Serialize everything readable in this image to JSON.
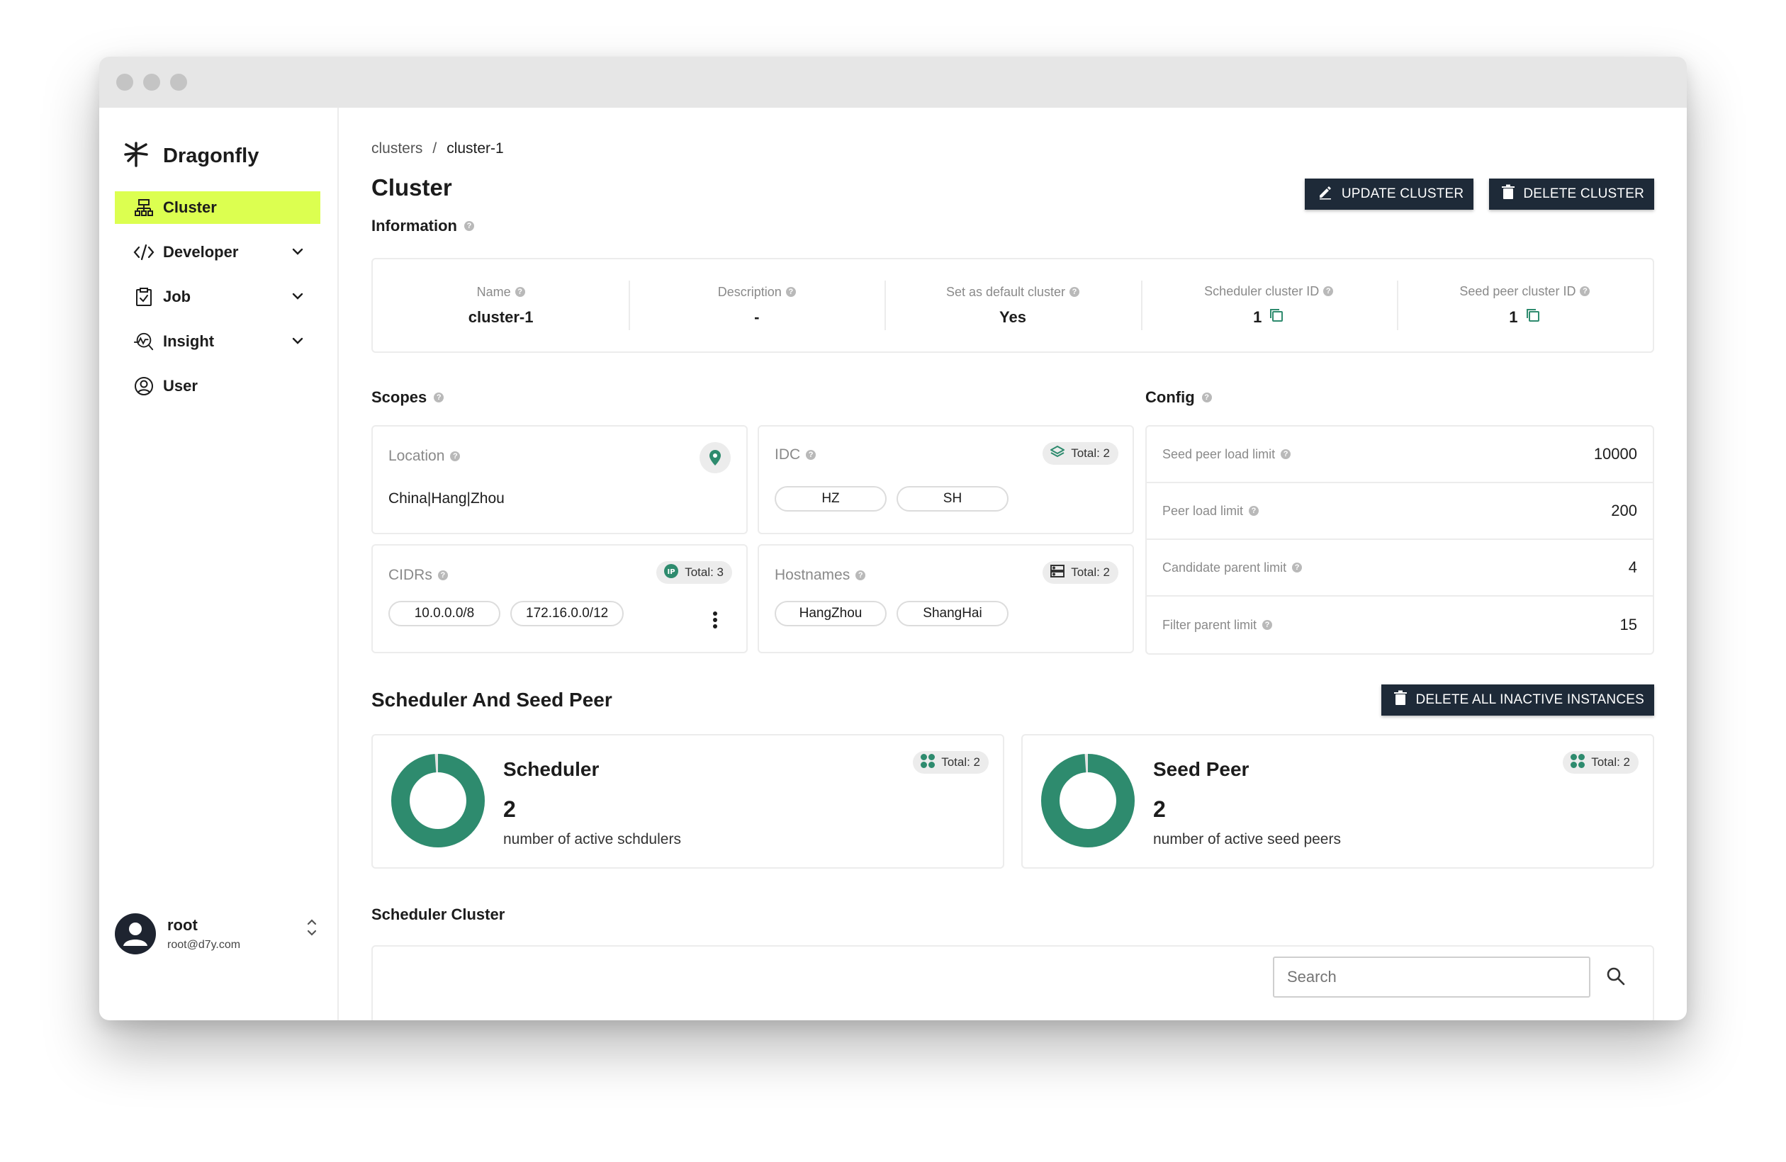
{
  "sidebar": {
    "brand": "Dragonfly",
    "items": [
      {
        "label": "Cluster"
      },
      {
        "label": "Developer"
      },
      {
        "label": "Job"
      },
      {
        "label": "Insight"
      },
      {
        "label": "User"
      }
    ],
    "user": {
      "name": "root",
      "email": "root@d7y.com"
    }
  },
  "breadcrumb": {
    "root": "clusters",
    "separator": "/",
    "current": "cluster-1"
  },
  "page": {
    "title": "Cluster",
    "update_label": "UPDATE CLUSTER",
    "delete_label": "DELETE CLUSTER"
  },
  "information": {
    "title": "Information",
    "fields": [
      {
        "label": "Name",
        "value": "cluster-1"
      },
      {
        "label": "Description",
        "value": "-"
      },
      {
        "label": "Set as default cluster",
        "value": "Yes"
      },
      {
        "label": "Scheduler cluster ID",
        "value": "1"
      },
      {
        "label": "Seed peer cluster ID",
        "value": "1"
      }
    ]
  },
  "scopes": {
    "title": "Scopes",
    "location": {
      "label": "Location",
      "value": "China|Hang|Zhou"
    },
    "idc": {
      "label": "IDC",
      "total": "Total: 2",
      "items": [
        "HZ",
        "SH"
      ]
    },
    "cidrs": {
      "label": "CIDRs",
      "total": "Total: 3",
      "items": [
        "10.0.0.0/8",
        "172.16.0.0/12"
      ]
    },
    "hostnames": {
      "label": "Hostnames",
      "total": "Total: 2",
      "items": [
        "HangZhou",
        "ShangHai"
      ]
    }
  },
  "config": {
    "title": "Config",
    "rows": [
      {
        "label": "Seed peer load limit",
        "value": "10000"
      },
      {
        "label": "Peer load limit",
        "value": "200"
      },
      {
        "label": "Candidate parent limit",
        "value": "4"
      },
      {
        "label": "Filter parent limit",
        "value": "15"
      }
    ]
  },
  "scheduler_seed": {
    "title": "Scheduler And Seed Peer",
    "delete_inactive_label": "DELETE ALL INACTIVE INSTANCES",
    "scheduler": {
      "name": "Scheduler",
      "count": "2",
      "desc": "number of active schdulers",
      "total": "Total: 2",
      "active_fraction": 1.0
    },
    "seed_peer": {
      "name": "Seed Peer",
      "count": "2",
      "desc": "number of active seed peers",
      "total": "Total: 2",
      "active_fraction": 1.0
    }
  },
  "scheduler_cluster": {
    "title": "Scheduler Cluster",
    "search_placeholder": "Search"
  },
  "colors": {
    "accent": "#dcff50",
    "primary_dark": "#1e2a38",
    "donut": "#2e8b6e"
  }
}
